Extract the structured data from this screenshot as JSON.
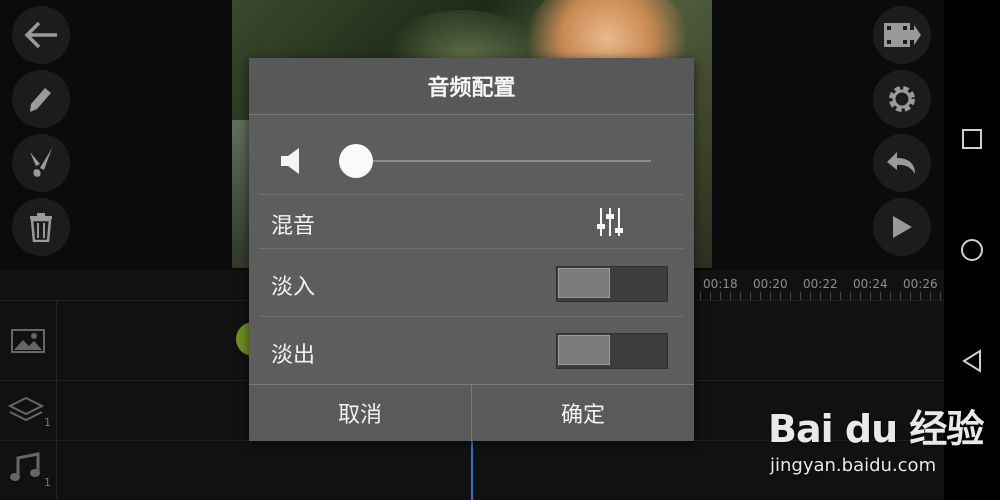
{
  "dialog": {
    "title": "音频配置",
    "volume_level": 0,
    "mix_label": "混音",
    "fade_in_label": "淡入",
    "fade_in_on": false,
    "fade_out_label": "淡出",
    "fade_out_on": false,
    "cancel_label": "取消",
    "confirm_label": "确定"
  },
  "timeline": {
    "ruler_labels": [
      "00:18",
      "00:20",
      "00:22",
      "00:24",
      "00:26"
    ],
    "track_badges": [
      "1",
      "1"
    ]
  },
  "left_toolbar": [
    "back-arrow-icon",
    "pencil-icon",
    "brush-icon",
    "trash-icon"
  ],
  "right_toolbar": [
    "export-film-icon",
    "gear-icon",
    "undo-icon",
    "play-icon"
  ],
  "navbar": [
    "recent-apps-square-icon",
    "home-circle-icon",
    "back-triangle-icon"
  ],
  "watermark": {
    "logo": "Bai du 经验",
    "url": "jingyan.baidu.com"
  },
  "colors": {
    "dialog_bg": "#5d5d5d",
    "playhead": "#2f6fd6",
    "accent_green": "#6f8e22"
  }
}
